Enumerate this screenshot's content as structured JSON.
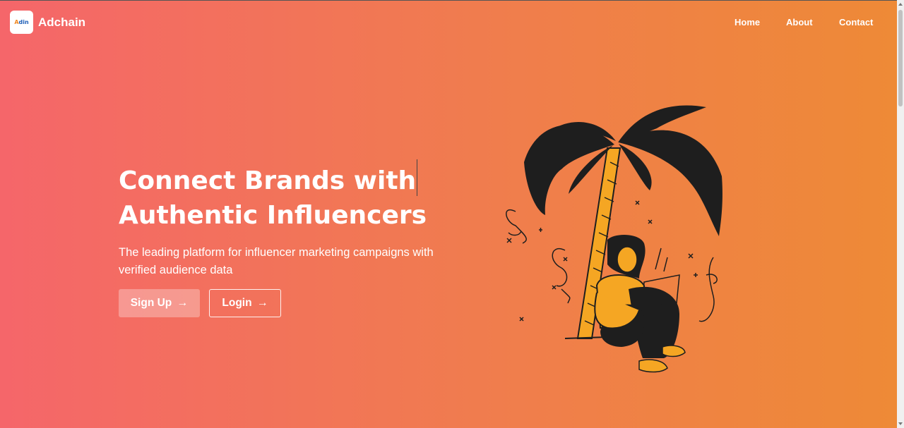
{
  "brand": {
    "logo_text_a": "A",
    "logo_text_rest": "din",
    "name": "Adchain"
  },
  "nav": {
    "links": [
      "Home",
      "About",
      "Contact"
    ]
  },
  "hero": {
    "title_line1": "Connect Brands with",
    "title_line2": "Authentic Influencers",
    "subtitle": "The leading platform for influencer marketing campaigns with verified audience data"
  },
  "buttons": {
    "signup_label": "Sign Up",
    "login_label": "Login",
    "arrow_glyph": "→"
  },
  "colors": {
    "gradient_start": "#f5666a",
    "gradient_end": "#ee8a36",
    "accent_orange": "#f5a623",
    "dark": "#1e1e1e"
  },
  "icons": [
    "arrow-right-icon",
    "palm-tree-illustration"
  ]
}
